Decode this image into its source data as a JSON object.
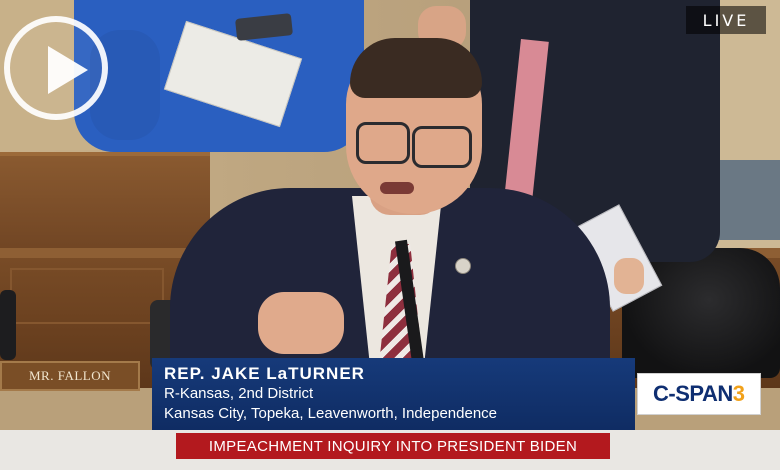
{
  "player": {
    "live_label": "LIVE"
  },
  "scene": {
    "nameplate": "MR. FALLON"
  },
  "lower_third": {
    "name": "REP. JAKE LaTURNER",
    "party_district": "R-Kansas, 2nd District",
    "locations": "Kansas City, Topeka, Leavenworth, Independence"
  },
  "network": {
    "logo_text": "C-SPAN",
    "logo_number": "3"
  },
  "ticker": {
    "headline": "IMPEACHMENT INQUIRY INTO PRESIDENT BIDEN"
  },
  "colors": {
    "lower_third_bg": "#123470",
    "ticker_bg": "#b3191e",
    "logo_accent": "#f1a11a"
  }
}
